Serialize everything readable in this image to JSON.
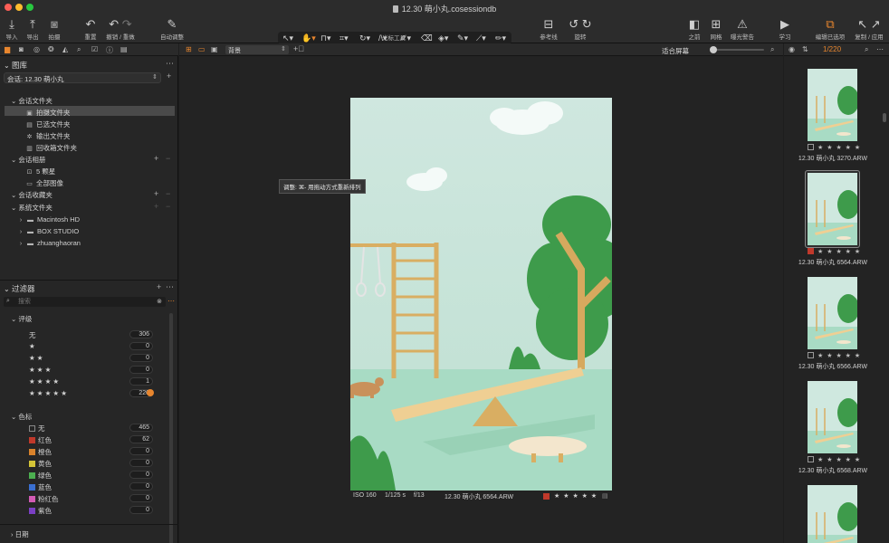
{
  "window": {
    "title": "12.30 萌小丸.cosessiondb"
  },
  "toolbar": {
    "import": "导入",
    "export": "导出",
    "capture": "拍摄",
    "reset": "重置",
    "undo_redo": "撤销 / 重做",
    "auto_adjust": "自动调整",
    "cursor_tools": "光标工具",
    "reference_line": "参考线",
    "rotate": "旋转",
    "before": "之前",
    "grid": "网格",
    "exposure_warning": "曝光警告",
    "learn": "学习",
    "edit_selected": "编辑已选项",
    "copy_apply": "复制 / 应用"
  },
  "library": {
    "title": "图库",
    "session": "会话: 12.30  萌小丸",
    "session_folders_title": "会话文件夹",
    "session_folders": [
      {
        "label": "拍摄文件夹",
        "icon": "camera-folder-icon"
      },
      {
        "label": "已选文件夹",
        "icon": "selects-folder-icon"
      },
      {
        "label": "输出文件夹",
        "icon": "gear-icon"
      },
      {
        "label": "回收箱文件夹",
        "icon": "trash-icon"
      }
    ],
    "session_albums_title": "会话相册",
    "session_albums": [
      {
        "label": "5 颗星",
        "icon": "smart-album-icon"
      },
      {
        "label": "全部图像",
        "icon": "album-icon"
      }
    ],
    "session_favorites_title": "会话收藏夹",
    "system_folders_title": "系统文件夹",
    "system_folders": [
      {
        "label": "Macintosh HD"
      },
      {
        "label": "BOX STUDIO"
      },
      {
        "label": "zhuanghaoran"
      }
    ]
  },
  "filters": {
    "title": "过滤器",
    "search_placeholder": "搜索",
    "rating_title": "评级",
    "ratings": [
      {
        "label": "无",
        "count": "306"
      },
      {
        "label": "★",
        "count": "0"
      },
      {
        "label": "★ ★",
        "count": "0"
      },
      {
        "label": "★ ★ ★",
        "count": "0"
      },
      {
        "label": "★ ★ ★ ★",
        "count": "1"
      },
      {
        "label": "★ ★ ★ ★ ★",
        "count": "220"
      }
    ],
    "color_title": "色标",
    "colors": [
      {
        "label": "无",
        "count": "465",
        "color": "#262626"
      },
      {
        "label": "红色",
        "count": "62",
        "color": "#c0392b"
      },
      {
        "label": "橙色",
        "count": "0",
        "color": "#d9822b"
      },
      {
        "label": "黄色",
        "count": "0",
        "color": "#d4c437"
      },
      {
        "label": "绿色",
        "count": "0",
        "color": "#4caf50"
      },
      {
        "label": "蓝色",
        "count": "0",
        "color": "#3a6fd1"
      },
      {
        "label": "粉红色",
        "count": "0",
        "color": "#d35bb4"
      },
      {
        "label": "紫色",
        "count": "0",
        "color": "#7b3fc4"
      }
    ],
    "date_title": "日期"
  },
  "viewer": {
    "layer": "背景",
    "fit": "适合屏幕",
    "tooltip": "调整: ⌘- 用拖动方式重新排列",
    "iso": "ISO 160",
    "shutter": "1/125 s",
    "aperture": "f/13",
    "filename": "12.30  萌小丸 6564.ARW",
    "stars": "★ ★ ★ ★ ★"
  },
  "browser": {
    "counter": "1/220",
    "thumbs": [
      {
        "name": "12.30  萌小丸 3270.ARW",
        "label": "none"
      },
      {
        "name": "12.30  萌小丸 6564.ARW",
        "label": "red"
      },
      {
        "name": "12.30  萌小丸 6566.ARW",
        "label": "none"
      },
      {
        "name": "12.30  萌小丸 6568.ARW",
        "label": "none"
      }
    ],
    "stars": "★ ★ ★ ★ ★"
  },
  "colors": {
    "accent": "#e8862e",
    "selection": "#4a4a4a"
  }
}
